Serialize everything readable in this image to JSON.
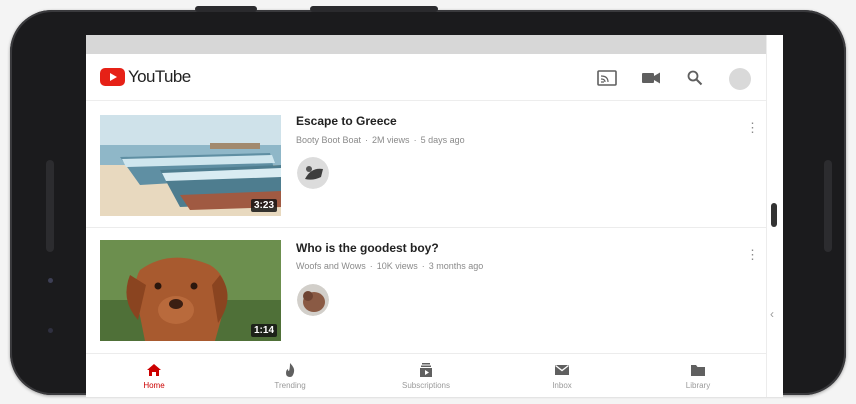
{
  "app": {
    "logo_text": "YouTube"
  },
  "colors": {
    "brand_red": "#e62117",
    "active_nav": "#cc0000"
  },
  "appbar": {
    "icons": [
      "cast-icon",
      "camera-icon",
      "search-icon",
      "account-avatar"
    ]
  },
  "videos": [
    {
      "title": "Escape to Greece",
      "channel": "Booty Boot Boat",
      "views": "2M views",
      "age": "5 days ago",
      "duration": "3:23",
      "more": "⋮"
    },
    {
      "title": "Who is the goodest boy?",
      "channel": "Woofs and Wows",
      "views": "10K views",
      "age": "3 months ago",
      "duration": "1:14",
      "more": "⋮"
    }
  ],
  "bottom_nav": [
    {
      "label": "Home",
      "icon": "home-icon",
      "active": true
    },
    {
      "label": "Trending",
      "icon": "flame-icon",
      "active": false
    },
    {
      "label": "Subscriptions",
      "icon": "subscriptions-icon",
      "active": false
    },
    {
      "label": "Inbox",
      "icon": "mail-icon",
      "active": false
    },
    {
      "label": "Library",
      "icon": "folder-icon",
      "active": false
    }
  ],
  "system": {
    "back": "‹"
  }
}
